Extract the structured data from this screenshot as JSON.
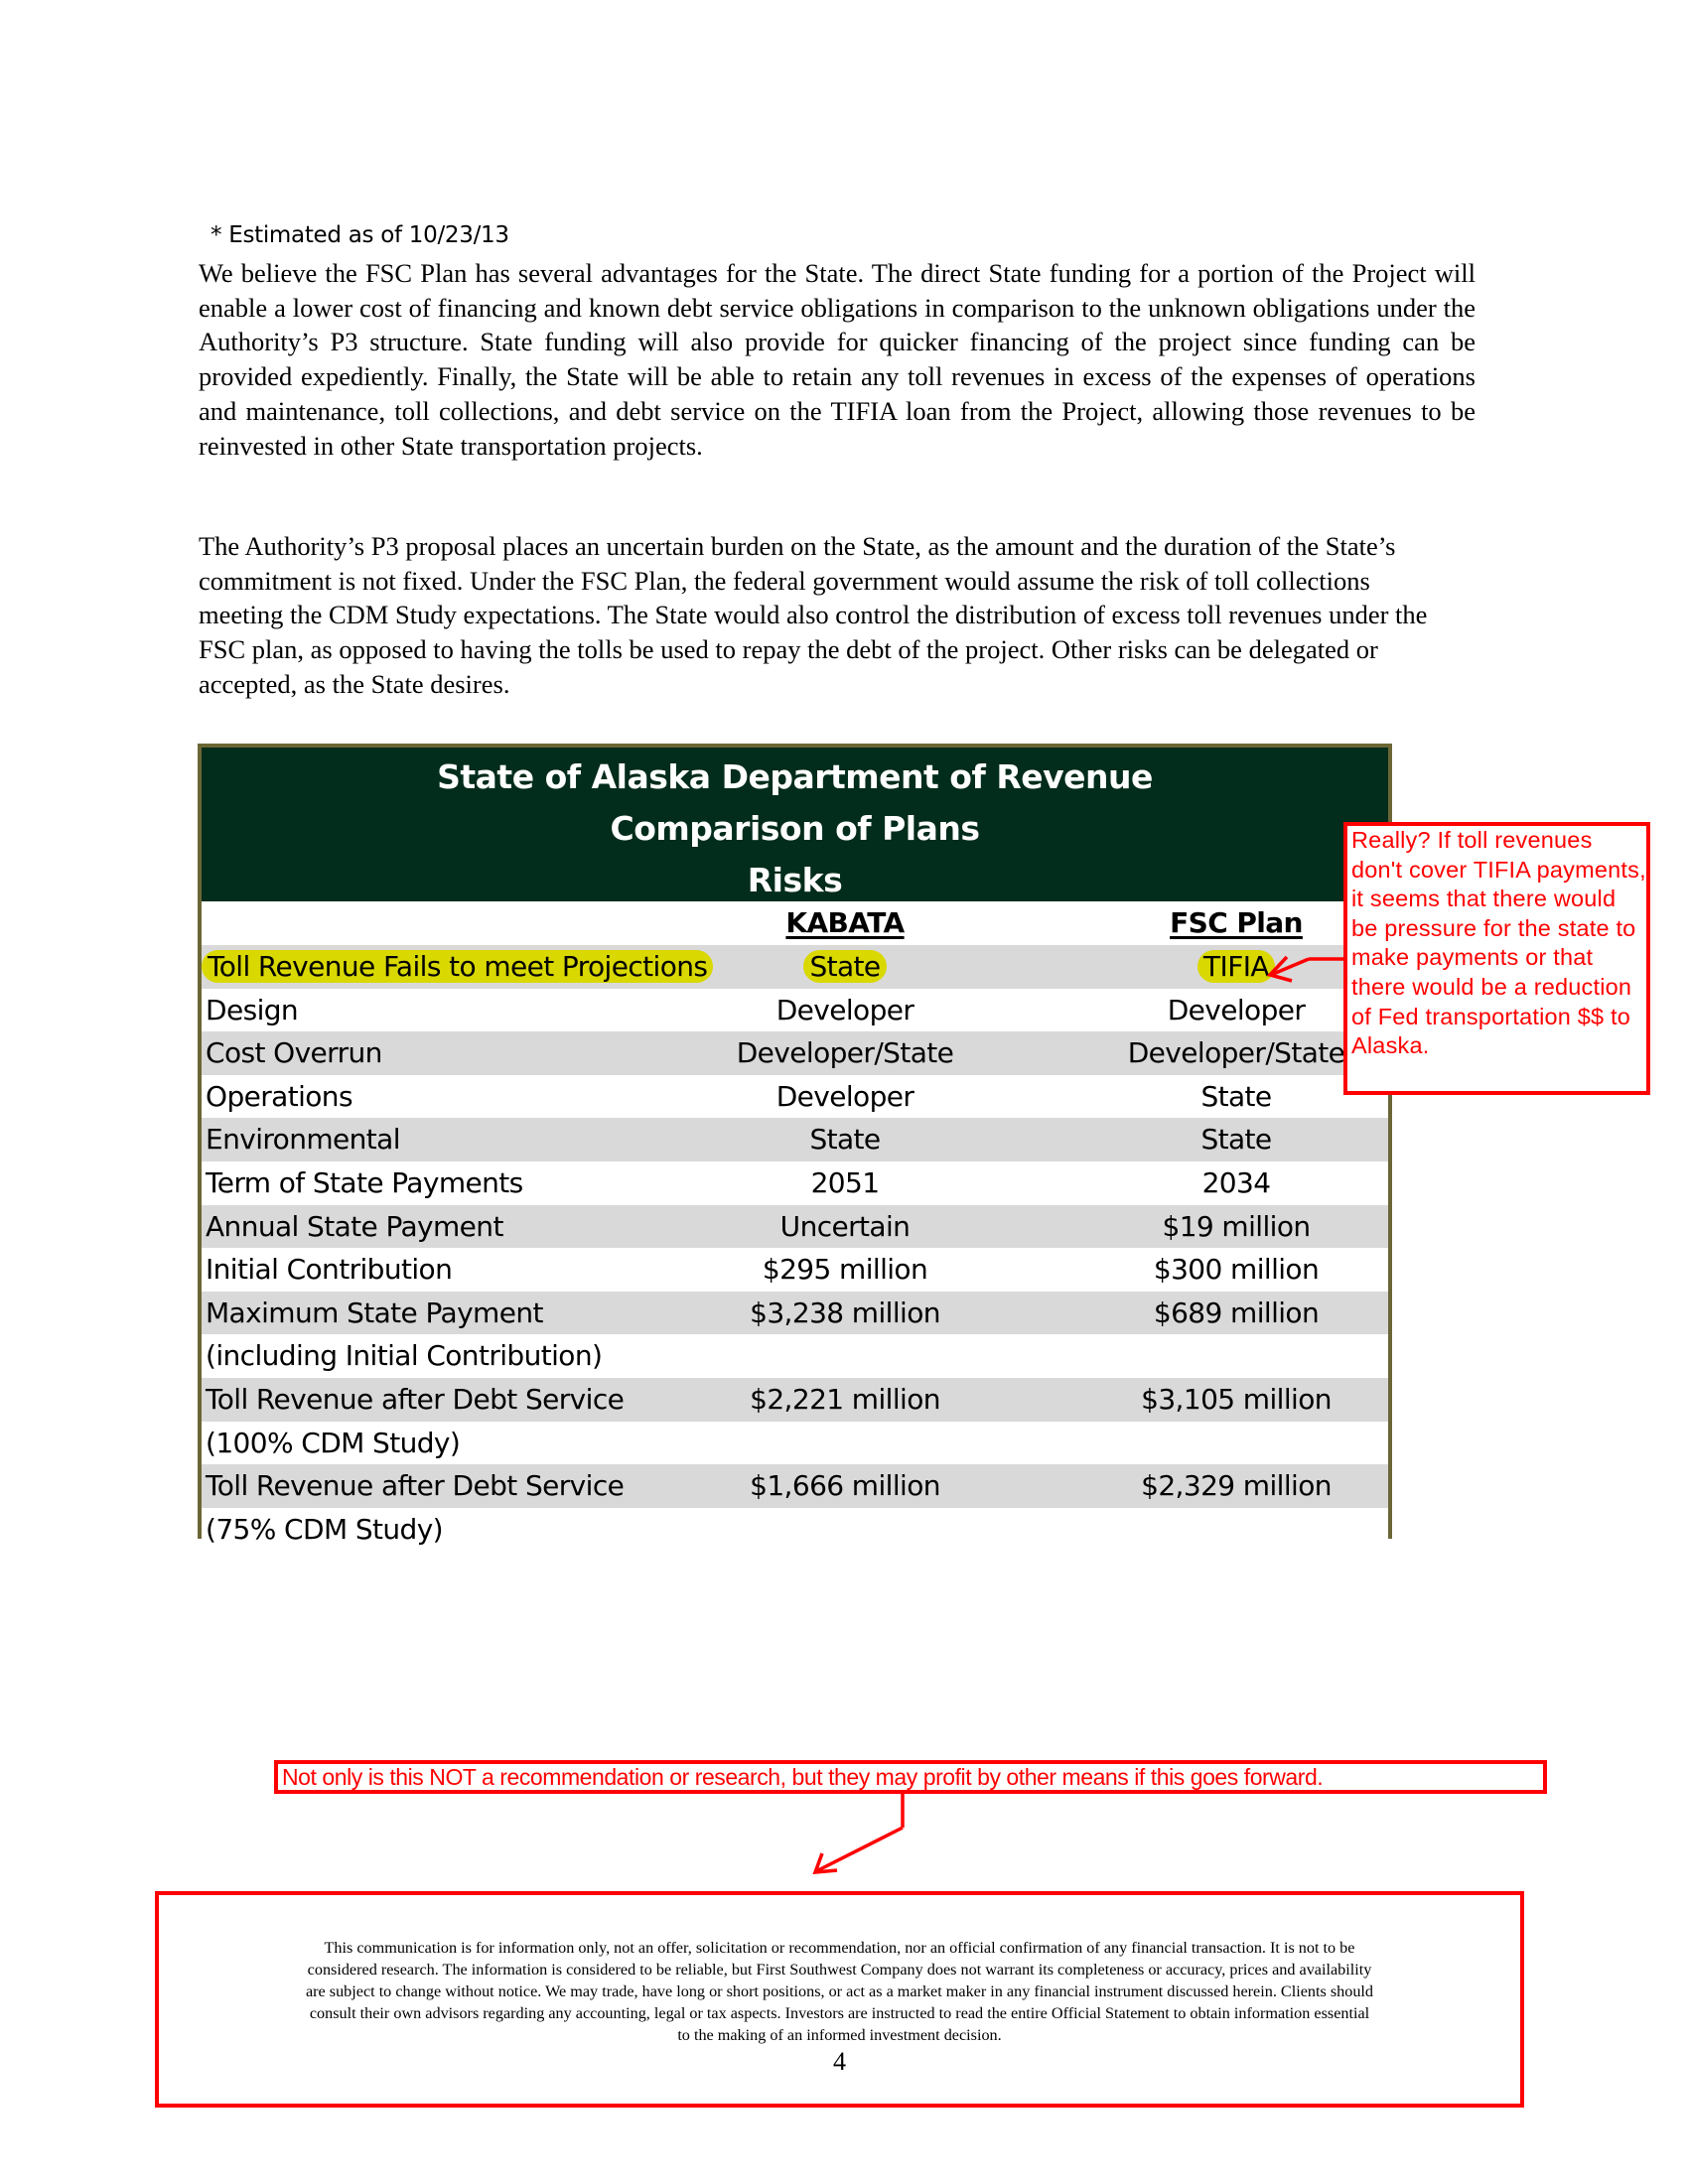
{
  "footnote": "* Estimated as of 10/23/13",
  "paragraphs": [
    "We believe the FSC Plan has several advantages for the State. The direct State funding for a portion of the Project will enable a lower cost of financing and known debt service obligations in comparison to the unknown obligations under the Authority’s P3 structure. State funding will also provide for quicker financing of the project since funding can be provided expediently. Finally, the State will be able to retain any toll revenues in excess of the expenses of operations and maintenance, toll collections, and debt service on the TIFIA loan from the Project, allowing those revenues to be reinvested in other State transportation projects.",
    "The Authority’s P3 proposal places an uncertain burden on the State, as the amount and the duration of the State’s commitment is not fixed. Under the FSC Plan, the federal government would assume the risk of toll collections meeting the CDM Study expectations.  The State would also control the distribution of excess toll revenues under the FSC plan, as opposed to having the tolls be used to repay the debt of the project.  Other risks can be delegated or accepted, as the State desires."
  ],
  "table": {
    "title_lines": [
      "State of Alaska Department of Revenue",
      "Comparison of Plans",
      "Risks"
    ],
    "columns": [
      "",
      "KABATA",
      "FSC Plan"
    ],
    "rows": [
      {
        "label": "Toll Revenue Fails to meet Projections",
        "kabata": "State",
        "fsc": "TIFIA",
        "highlighted": true
      },
      {
        "label": "Design",
        "kabata": "Developer",
        "fsc": "Developer"
      },
      {
        "label": "Cost Overrun",
        "kabata": "Developer/State",
        "fsc": "Developer/State"
      },
      {
        "label": "Operations",
        "kabata": "Developer",
        "fsc": "State"
      },
      {
        "label": "Environmental",
        "kabata": "State",
        "fsc": "State"
      },
      {
        "label": "Term of State Payments",
        "kabata": "2051",
        "fsc": "2034"
      },
      {
        "label": "Annual State Payment",
        "kabata": "Uncertain",
        "fsc": "$19 million"
      },
      {
        "label": "Initial Contribution",
        "kabata": "$295 million",
        "fsc": "$300 million"
      },
      {
        "label": "Maximum State Payment",
        "kabata": "$3,238 million",
        "fsc": "$689 million"
      },
      {
        "label": "(including Initial Contribution)",
        "kabata": "",
        "fsc": ""
      },
      {
        "label": "Toll Revenue after Debt Service",
        "kabata": "$2,221 million",
        "fsc": "$3,105 million"
      },
      {
        "label": "(100% CDM Study)",
        "kabata": "",
        "fsc": ""
      },
      {
        "label": "Toll Revenue after Debt Service",
        "kabata": "$1,666 million",
        "fsc": "$2,329 million"
      },
      {
        "label": "(75% CDM Study)",
        "kabata": "",
        "fsc": ""
      }
    ]
  },
  "annotations": {
    "comment": "Really?  If toll revenues don't cover TIFIA payments, it seems that there would be pressure for the state to make payments or that there would be a reduction of Fed transportation $$ to Alaska.",
    "note": "Not only is this NOT a recommendation or research, but they may profit by other means if this goes forward.",
    "color": "#ff0000"
  },
  "disclaimer": {
    "lines": [
      "This communication is for information only, not an offer, solicitation or recommendation, nor an official confirmation of any financial transaction. It is not to be",
      "considered research. The information is considered to be reliable, but First Southwest Company does not warrant its completeness or accuracy, prices and availability",
      "are subject to change without notice. We may trade, have long or short positions, or act as a market maker in any financial instrument discussed herein. Clients should",
      "consult their own advisors regarding any accounting, legal or tax aspects. Investors are instructed to read the entire Official Statement to obtain information essential",
      "to the making of an informed investment decision."
    ],
    "page_number": "4"
  },
  "colors": {
    "table_header_bg": "#022c1b",
    "table_border": "#6b6636",
    "row_stripe": "#d9d9d9",
    "highlight": "#d9d800"
  }
}
